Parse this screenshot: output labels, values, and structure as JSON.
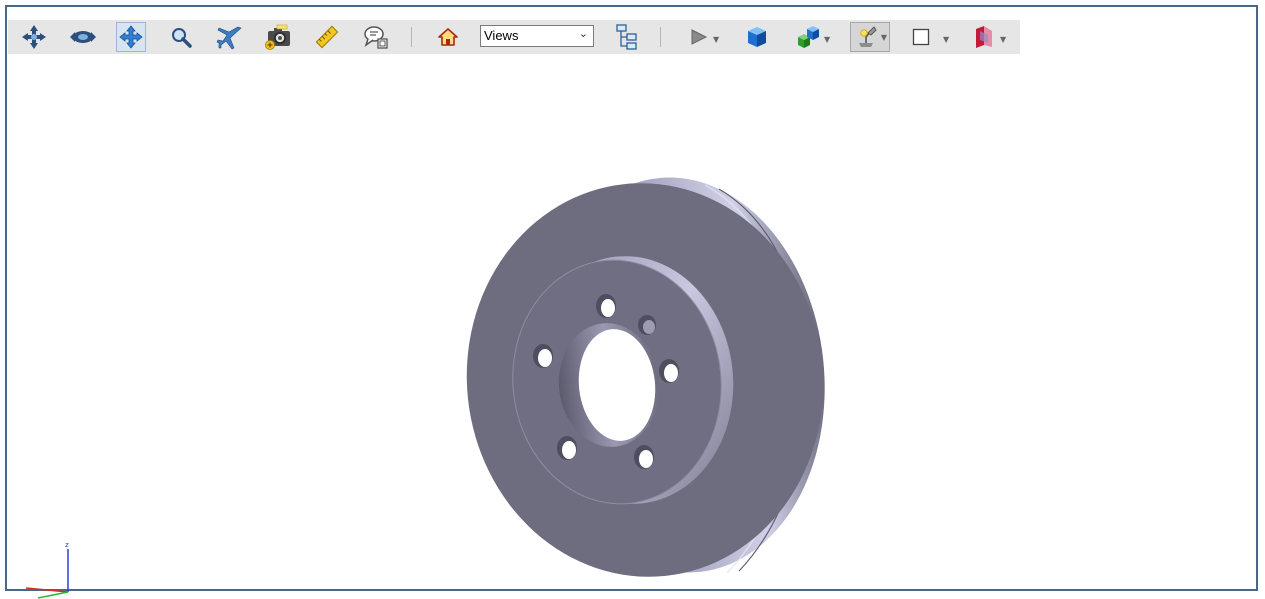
{
  "toolbar": {
    "buttons": [
      {
        "name": "rotate-icon"
      },
      {
        "name": "orbit-icon"
      },
      {
        "name": "pan-icon"
      },
      {
        "name": "zoom-icon"
      },
      {
        "name": "fly-icon"
      },
      {
        "name": "snapshot-icon"
      },
      {
        "name": "measure-icon"
      },
      {
        "name": "comment-icon"
      },
      {
        "name": "home-icon"
      },
      {
        "name": "model-tree-icon"
      },
      {
        "name": "play-icon"
      },
      {
        "name": "render-mode-icon"
      },
      {
        "name": "explode-icon"
      },
      {
        "name": "lighting-icon"
      },
      {
        "name": "background-icon"
      },
      {
        "name": "section-icon"
      }
    ],
    "views_dropdown": {
      "selected": "Views"
    }
  },
  "viewport": {
    "model": "brake-disc",
    "axis_triad": {
      "z_label": "z"
    },
    "colors": {
      "frame_border": "#4a6785",
      "disc_face": "#6e6d80",
      "disc_rim": "#8c8ba0",
      "background": "#ffffff"
    }
  }
}
